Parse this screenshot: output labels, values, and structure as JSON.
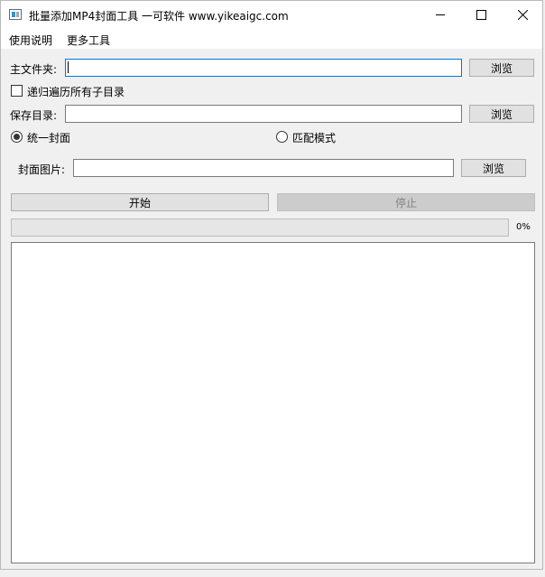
{
  "window": {
    "title": "批量添加MP4封面工具 一可软件 www.yikeaigc.com"
  },
  "menu": {
    "items": [
      "使用说明",
      "更多工具"
    ]
  },
  "main_folder": {
    "label": "主文件夹:",
    "value": "",
    "browse": "浏览"
  },
  "recursive": {
    "label": "递归遍历所有子目录",
    "checked": false
  },
  "save_dir": {
    "label": "保存目录:",
    "value": "",
    "browse": "浏览"
  },
  "mode": {
    "unified_label": "统一封面",
    "match_label": "匹配模式",
    "selected": "统一封面"
  },
  "cover_image": {
    "label": "封面图片:",
    "value": "",
    "browse": "浏览"
  },
  "actions": {
    "start": "开始",
    "stop": "停止"
  },
  "progress": {
    "value": 0,
    "text": "0%"
  },
  "log": {
    "content": ""
  }
}
